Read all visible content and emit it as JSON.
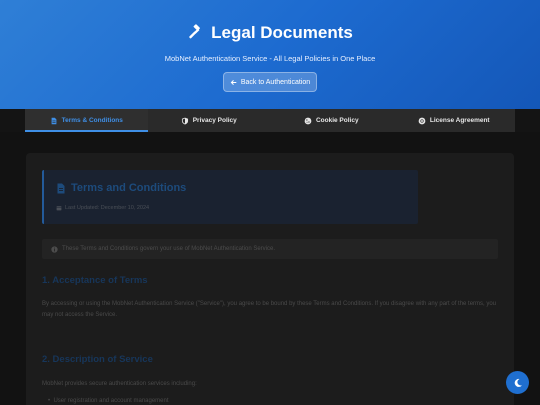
{
  "header": {
    "title": "Legal Documents",
    "subtitle": "MobNet Authentication Service - All Legal Policies in One Place",
    "back_label": "Back to Authentication",
    "icon": "gavel-icon",
    "gradient_from": "#2f7fd6",
    "gradient_to": "#1457b8"
  },
  "tabs": [
    {
      "label": "Terms & Conditions",
      "icon": "document-icon",
      "active": true
    },
    {
      "label": "Privacy Policy",
      "icon": "shield-icon",
      "active": false
    },
    {
      "label": "Cookie Policy",
      "icon": "cookie-icon",
      "active": false
    },
    {
      "label": "License Agreement",
      "icon": "certificate-icon",
      "active": false
    }
  ],
  "document": {
    "title": "Terms and Conditions",
    "last_updated": "Last Updated: December 10, 2024",
    "info": "These Terms and Conditions govern your use of MobNet Authentication Service.",
    "sections": [
      {
        "title": "1. Acceptance of Terms",
        "text": "By accessing or using the MobNet Authentication Service (\"Service\"), you agree to be bound by these Terms and Conditions. If you disagree with any part of the terms, you may not access the Service."
      },
      {
        "title": "2. Description of Service",
        "text": "MobNet provides secure authentication services including:",
        "bullets": [
          "User registration and account management"
        ]
      }
    ]
  },
  "theme_toggle": {
    "icon": "moon-icon",
    "accent": "#1f6fd0"
  }
}
